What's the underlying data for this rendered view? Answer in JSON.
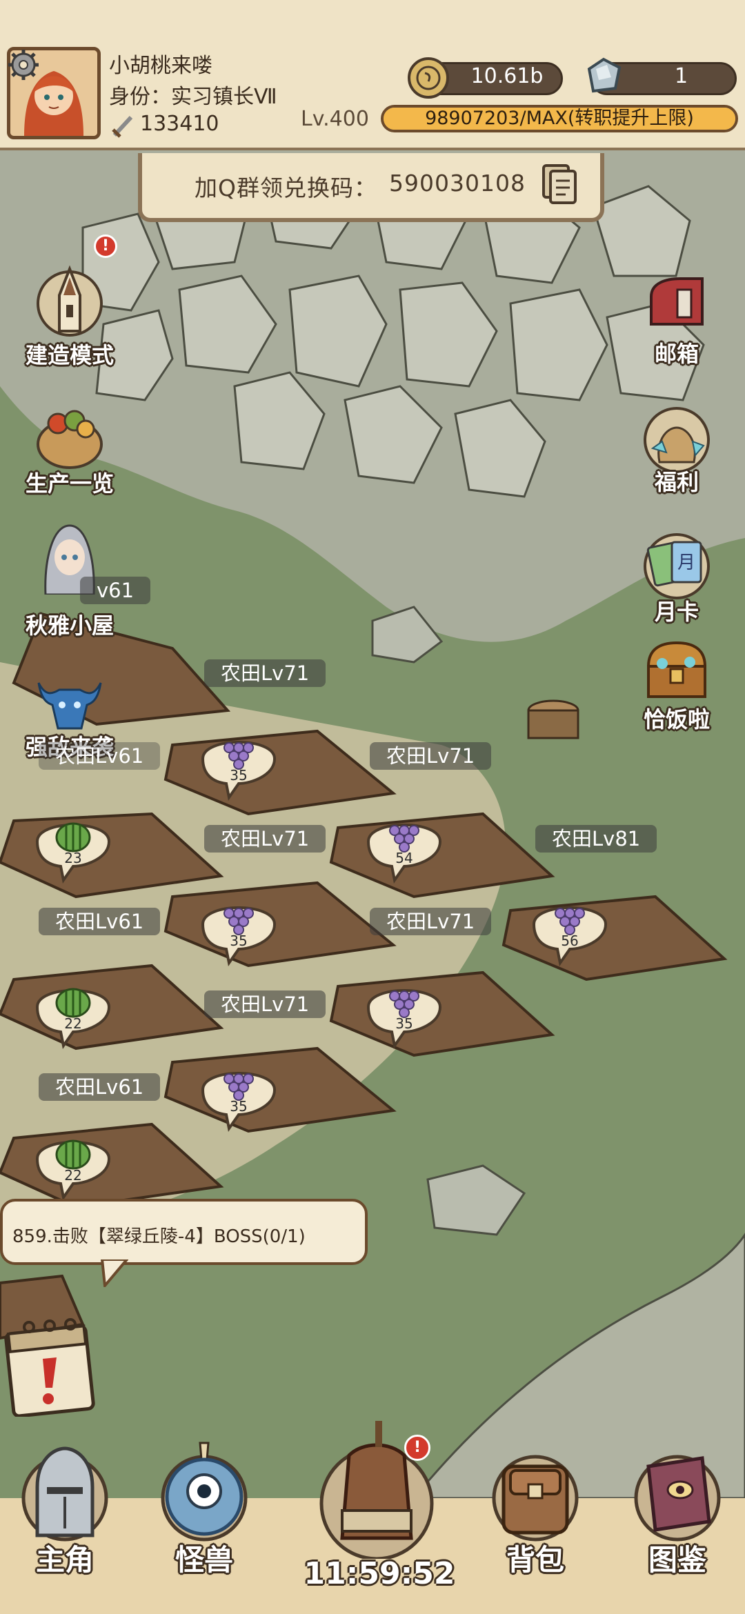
{
  "header": {
    "player_name": "小胡桃来喽",
    "player_title": "身份：实习镇长Ⅶ",
    "power": "133410",
    "gold": "10.61b",
    "gems": "1",
    "level": "Lv.400",
    "exp": "98907203/MAX(转职提升上限)",
    "exp_fraction": 1.0
  },
  "redeem": {
    "label": "加Q群领兑换码：",
    "code": "590030108"
  },
  "left_menu": {
    "build": "建造模式",
    "production": "生产一览",
    "qiuya": "秋雅小屋",
    "enemy": "强敌来袭"
  },
  "right_menu": {
    "mail": "邮箱",
    "welfare": "福利",
    "monthly": "月卡",
    "meal": "恰饭啦"
  },
  "farms": [
    {
      "label": "v61",
      "crop": "",
      "count": ""
    },
    {
      "label": "农田Lv71",
      "crop": "",
      "count": ""
    },
    {
      "label": "农田Lv61",
      "crop": "",
      "count": ""
    },
    {
      "label": "农田Lv71",
      "crop": "",
      "count": ""
    },
    {
      "label": "农田Lv71",
      "crop": "",
      "count": ""
    },
    {
      "label": "农田Lv81",
      "crop": "",
      "count": ""
    },
    {
      "label": "农田Lv61",
      "crop": "",
      "count": ""
    },
    {
      "label": "农田Lv71",
      "crop": "",
      "count": ""
    },
    {
      "label": "农田Lv71",
      "crop": "",
      "count": ""
    },
    {
      "label": "农田Lv61",
      "crop": "",
      "count": ""
    }
  ],
  "bubbles": [
    {
      "crop": "grape",
      "count": "35"
    },
    {
      "crop": "watermelon",
      "count": "23"
    },
    {
      "crop": "grape",
      "count": "54"
    },
    {
      "crop": "grape",
      "count": "35"
    },
    {
      "crop": "grape",
      "count": "56"
    },
    {
      "crop": "watermelon",
      "count": "22"
    },
    {
      "crop": "grape",
      "count": "35"
    },
    {
      "crop": "grape",
      "count": "35"
    },
    {
      "crop": "watermelon",
      "count": "22"
    }
  ],
  "quest": {
    "text": "859.击败【翠绿丘陵-4】BOSS(0/1)"
  },
  "bottom_nav": {
    "hero": "主角",
    "monster": "怪兽",
    "bag": "背包",
    "atlas": "图鉴",
    "timer": "11:59:52"
  },
  "colors": {
    "header_bg": "#efe3c6",
    "grass": "#7f936b",
    "farm_soil": "#7a5a3e",
    "badge_red": "#d33a2c"
  }
}
